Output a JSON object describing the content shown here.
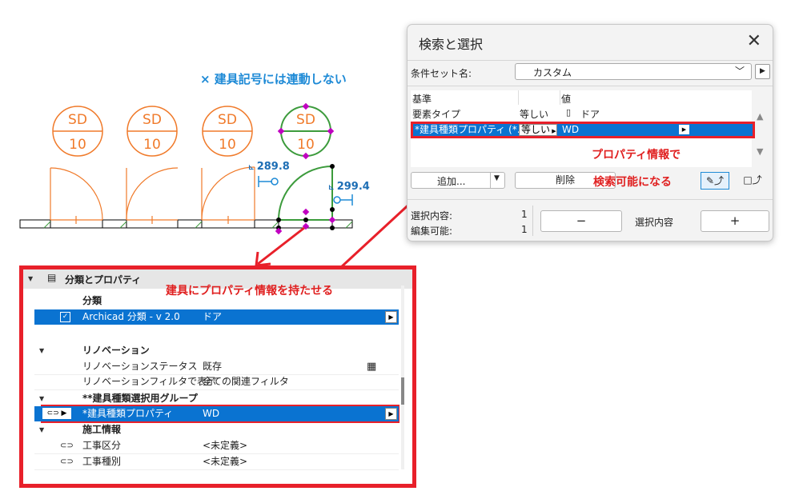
{
  "annotation_top": "× 建具記号には連動しない",
  "door_symbols": [
    {
      "top": "SD",
      "bottom": "10"
    },
    {
      "top": "SD",
      "bottom": "10"
    },
    {
      "top": "SD",
      "bottom": "10"
    },
    {
      "top": "SD",
      "bottom": "10"
    }
  ],
  "dimensions": {
    "d1": "289.8",
    "d2": "299.4"
  },
  "colors": {
    "orange": "#f07a2a",
    "green": "#3c9b3c",
    "magenta": "#c000c0",
    "red": "#e8202a",
    "select_blue": "#0a73d1",
    "blue_note": "#1e8ad6"
  },
  "dialog": {
    "title": "検索と選択",
    "close_icon": "close-icon",
    "criteria_set_label": "条件セット名:",
    "criteria_set_value": "カスタム",
    "headers": {
      "criterion": "基準",
      "value": "値"
    },
    "rows": [
      {
        "criterion": "要素タイプ",
        "operator": "等しい",
        "value": "ドア"
      },
      {
        "criterion": "*建具種類プロパティ (*...",
        "operator": "等しい",
        "value": "WD"
      }
    ],
    "add_label": "追加...",
    "delete_label": "削除",
    "note1": "プロパティ情報で",
    "note2": "検索可能になる",
    "selection_label": "選択内容:",
    "selection_count": "1",
    "editable_label": "編集可能:",
    "editable_count": "1",
    "minus_label": "−",
    "selection_center": "選択内容",
    "plus_label": "+"
  },
  "panel": {
    "section_title": "分類とプロパティ",
    "annotation": "建具にプロパティ情報を持たせる",
    "classification_header": "分類",
    "classification_row": {
      "name": "Archicad 分類 - v 2.0",
      "value": "ドア"
    },
    "renovation_header": "リノベーション",
    "renovation_rows": [
      {
        "name": "リノベーションステータス",
        "value": "既存"
      },
      {
        "name": "リノベーションフィルタで表示",
        "value": "全ての関連フィルタ"
      }
    ],
    "group_header": "**建具種類選択用グループ",
    "group_row": {
      "name": "*建具種類プロパティ",
      "value": "WD"
    },
    "construction_header": "施工情報",
    "construction_rows": [
      {
        "name": "工事区分",
        "value": "<未定義>"
      },
      {
        "name": "工事種別",
        "value": "<未定義>"
      }
    ]
  }
}
